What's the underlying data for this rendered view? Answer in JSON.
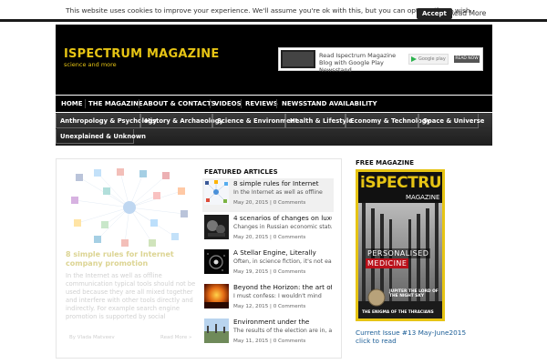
{
  "cookie_bar": {
    "text": "This website uses cookies to improve your experience. We'll assume you're ok with this, but you can opt-out if you wish.",
    "accept_label": "Accept",
    "read_more_label": "Read More"
  },
  "header": {
    "title": "ISPECTRUM MAGAZINE",
    "subtitle": "science and more",
    "banner": {
      "text": "Read Ispectrum Magazine Blog with Google Play Newsstand",
      "store_label": "Google play",
      "button_label": "READ NOW"
    }
  },
  "main_nav": {
    "items": [
      "HOME",
      "THE MAGAZINE",
      "ABOUT & CONTACTS",
      "VIDEOS",
      "REVIEWS",
      "NEWSSTAND AVAILABILITY"
    ]
  },
  "category_nav": {
    "items": [
      "Anthropology & Psychology",
      "History & Archaeology",
      "Science & Environment",
      "Health & Lifestyle",
      "Economy & Technology",
      "Space & Universe",
      "Unexplained & Unknown"
    ]
  },
  "featured": {
    "title": "8 simple rules for Internet company promotion",
    "excerpt": "In the Internet as well as offline communication typical tools should not be used because they are all mixed together and interfere with other tools directly and indirectly. For example search engine promotion is supported by social",
    "byline": "By Vlada Matveev",
    "read_more": "Read More »"
  },
  "featured_articles": {
    "heading": "FEATURED ARTICLES",
    "items": [
      {
        "title": "8 simple rules for Internet",
        "excerpt": "In the Internet as well as offline",
        "meta": "May 20, 2015 | 0 Comments"
      },
      {
        "title": "4 scenarios of changes on luxury",
        "excerpt": "Changes in Russian economic status",
        "meta": "May 20, 2015 | 0 Comments"
      },
      {
        "title": "A Stellar Engine, Literally",
        "excerpt": "Often, in science fiction, it's not easy",
        "meta": "May 19, 2015 | 0 Comments"
      },
      {
        "title": "Beyond the Horizon: the art of",
        "excerpt": "I must confess: I wouldn't mind",
        "meta": "May 12, 2015 | 0 Comments"
      },
      {
        "title": "Environment under the",
        "excerpt": "The results of the election are in, and",
        "meta": "May 11, 2015 | 0 Comments"
      }
    ]
  },
  "sidebar": {
    "heading": "FREE MAGAZINE",
    "cover": {
      "title": "iSPECTRUM",
      "subtitle": "MAGAZINE",
      "headline_1": "PERSONALISED",
      "headline_2": "MEDICINE",
      "jupiter": "JUPITER THE LORD OF THE NIGHT SKY",
      "enigma": "THE ENIGMA OF THE THRACIANS"
    },
    "issue_text": "Current Issue #13 May-June2015",
    "issue_link": "click to read"
  }
}
